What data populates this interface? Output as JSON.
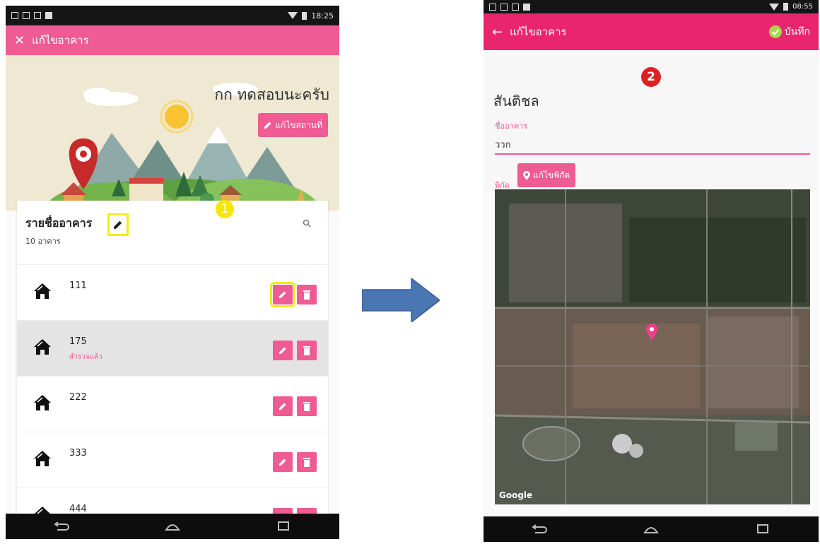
{
  "left": {
    "status": {
      "time": "18:25"
    },
    "appbar": {
      "title": "แก้ไขอาคาร"
    },
    "banner": {
      "location_name": "กก ทดสอบนะครับ",
      "edit_place_label": "แก้ไขสถานที่"
    },
    "marker": "1",
    "list": {
      "title": "รายชื่ออาคาร",
      "count": "10 อาคาร",
      "items": [
        {
          "name": "111",
          "sub": ""
        },
        {
          "name": "175",
          "sub": "สำรวจแล้ว"
        },
        {
          "name": "222",
          "sub": ""
        },
        {
          "name": "333",
          "sub": ""
        },
        {
          "name": "444",
          "sub": ""
        }
      ]
    }
  },
  "right": {
    "status": {
      "time": "08:55"
    },
    "appbar": {
      "title": "แก้ไขอาคาร",
      "save_label": "บันทึก"
    },
    "marker": "2",
    "heading": "สันติชล",
    "field": {
      "label": "ชื่ออาคาร",
      "value": "ววก"
    },
    "coord": {
      "label": "พิกัด",
      "button": "แก้ไขพิกัด"
    },
    "map_credit": "Google"
  },
  "colors": {
    "accent": "#ef5b93",
    "highlight": "#f3ec16",
    "arrow": "#4a76b4"
  }
}
